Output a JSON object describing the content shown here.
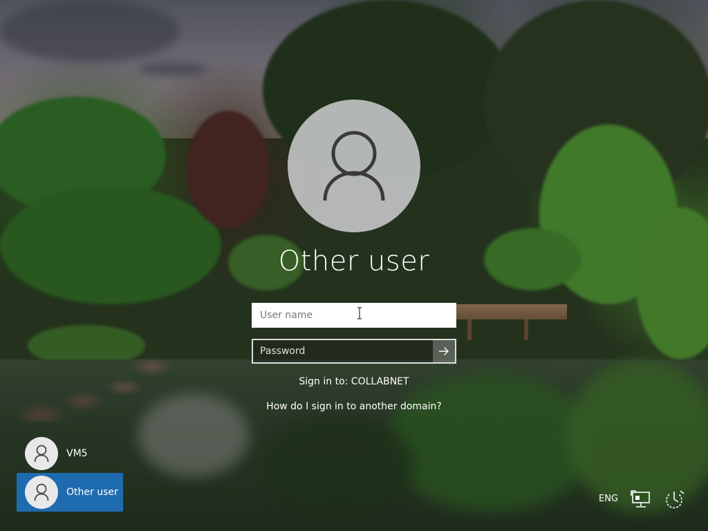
{
  "screen": {
    "title": "Other user"
  },
  "login": {
    "username_placeholder": "User name",
    "username_value": "",
    "password_placeholder": "Password",
    "password_value": "",
    "signin_to": "Sign in to: COLLABNET",
    "domain_help": "How do I sign in to another domain?"
  },
  "users": [
    {
      "name": "VM5",
      "selected": false,
      "icon": "user-avatar-icon"
    },
    {
      "name": "Other user",
      "selected": true,
      "icon": "user-avatar-icon"
    }
  ],
  "tray": {
    "language": "ENG",
    "network_icon": "network-icon",
    "power_icon": "power-icon"
  },
  "icons": {
    "avatar": "user-avatar-icon",
    "submit": "arrow-right-icon"
  },
  "colors": {
    "selected_tile": "#1f6bb0",
    "avatar_bg": "#dcdce0",
    "text": "#ffffff"
  }
}
